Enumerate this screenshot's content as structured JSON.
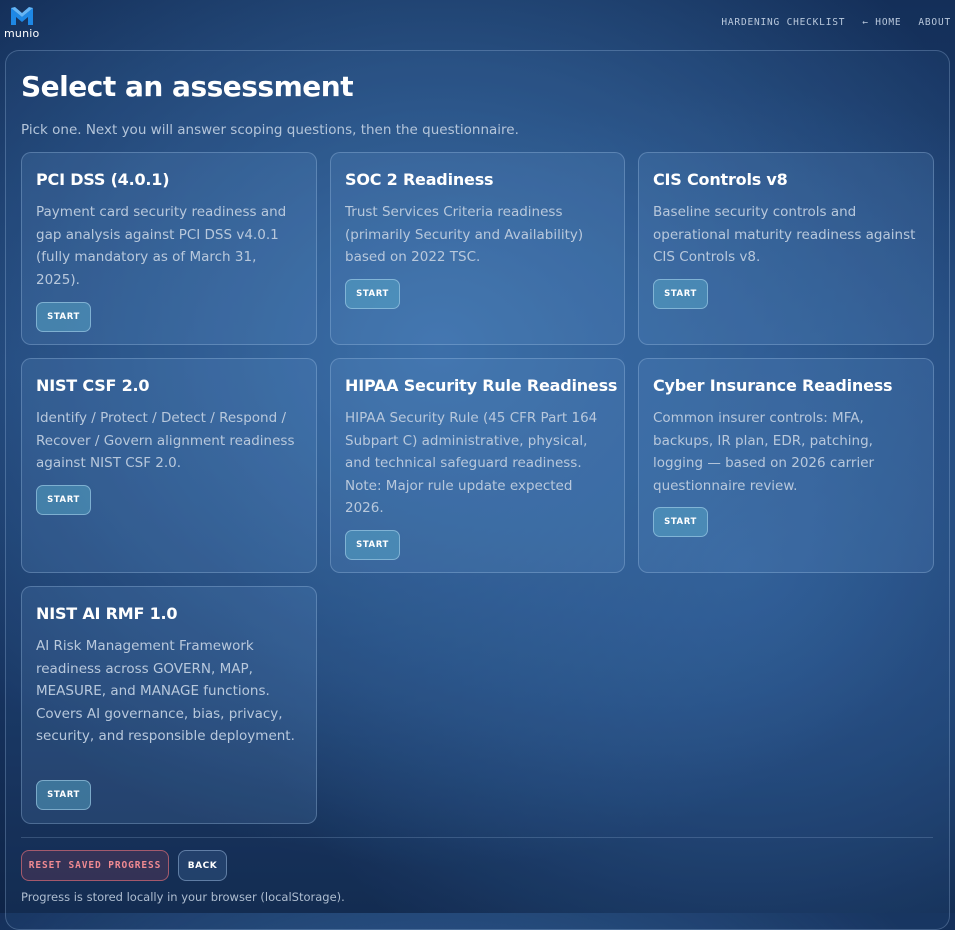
{
  "app": {
    "logo_text": "munio",
    "brand_color": "#1e88e5"
  },
  "nav": {
    "items": [
      {
        "label": "HARDENING CHECKLIST"
      },
      {
        "label": "← HOME"
      },
      {
        "label": "ABOUT"
      }
    ]
  },
  "page": {
    "title": "Select an assessment",
    "subtitle": "Pick one. Next you will answer scoping questions, then the questionnaire."
  },
  "cards": [
    {
      "title": "PCI DSS (4.0.1)",
      "description": "Payment card security readiness and gap analysis against PCI DSS v4.0.1 (fully mandatory as of March 31, 2025).",
      "button": "START"
    },
    {
      "title": "SOC 2 Readiness",
      "description": "Trust Services Criteria readiness (primarily Security and Availability) based on 2022 TSC.",
      "button": "START"
    },
    {
      "title": "CIS Controls v8",
      "description": "Baseline security controls and operational maturity readiness against CIS Controls v8.",
      "button": "START"
    },
    {
      "title": "NIST CSF 2.0",
      "description": "Identify / Protect / Detect / Respond / Recover / Govern alignment readiness against NIST CSF 2.0.",
      "button": "START"
    },
    {
      "title": "HIPAA Security Rule Readiness",
      "description": "HIPAA Security Rule (45 CFR Part 164 Subpart C) administrative, physical, and technical safeguard readiness. Note: Major rule update expected 2026.",
      "button": "START"
    },
    {
      "title": "Cyber Insurance Readiness",
      "description": "Common insurer controls: MFA, backups, IR plan, EDR, patching, logging — based on 2026 carrier questionnaire review.",
      "button": "START"
    },
    {
      "title": "NIST AI RMF 1.0",
      "description": "AI Risk Management Framework readiness across GOVERN, MAP, MEASURE, and MANAGE functions. Covers AI governance, bias, privacy, security, and responsible deployment.",
      "button": "START"
    }
  ],
  "footer": {
    "reset_label": "RESET SAVED PROGRESS",
    "back_label": "BACK",
    "note": "Progress is stored locally in your browser (localStorage)."
  }
}
